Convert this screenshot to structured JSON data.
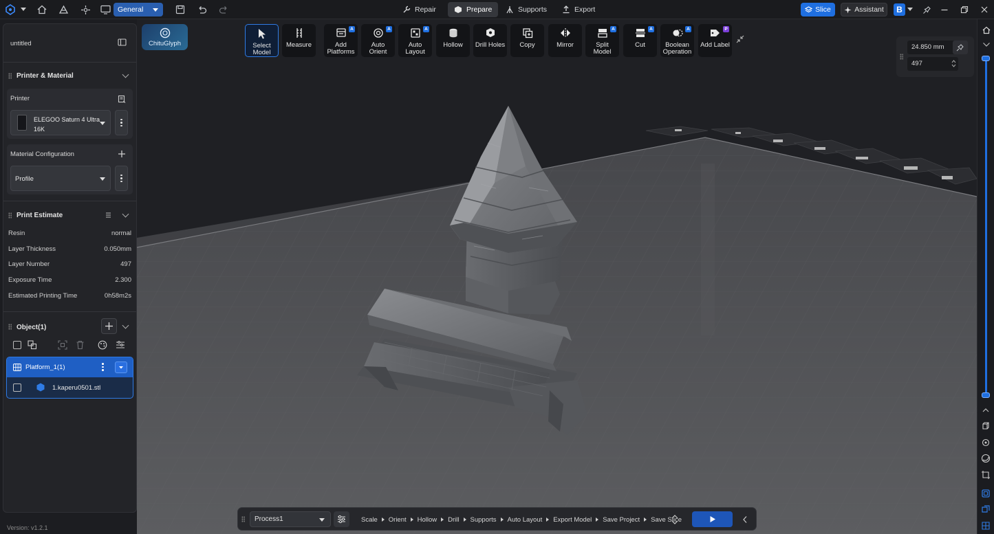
{
  "topbar": {
    "workspace": "General",
    "tabs": [
      {
        "label": "Repair",
        "icon": "wrench-icon"
      },
      {
        "label": "Prepare",
        "icon": "cube-icon"
      },
      {
        "label": "Supports",
        "icon": "support-icon"
      },
      {
        "label": "Export",
        "icon": "export-icon"
      }
    ],
    "active_tab": "Prepare",
    "slice_label": "Slice",
    "assistant_label": "Assistant",
    "profile_letter": "B",
    "accent_color": "#1f6fe0"
  },
  "tools": [
    {
      "label": [
        "Select",
        "Model"
      ],
      "icon": "cursor-icon"
    },
    {
      "label": [
        "Measure"
      ],
      "icon": "ruler-icon"
    },
    {
      "label": [
        "Add",
        "Platforms"
      ],
      "icon": "platforms-icon",
      "badge": "A"
    },
    {
      "label": [
        "Auto",
        "Orient"
      ],
      "icon": "orient-icon",
      "badge": "A"
    },
    {
      "label": [
        "Auto",
        "Layout"
      ],
      "icon": "layout-icon",
      "badge": "A"
    },
    {
      "label": [
        "Hollow"
      ],
      "icon": "hollow-icon"
    },
    {
      "label": [
        "Drill Holes"
      ],
      "icon": "drill-icon"
    },
    {
      "label": [
        "Copy"
      ],
      "icon": "copy-icon"
    },
    {
      "label": [
        "Mirror"
      ],
      "icon": "mirror-icon"
    },
    {
      "label": [
        "Split",
        "Model"
      ],
      "icon": "split-icon",
      "badge": "A"
    },
    {
      "label": [
        "Cut"
      ],
      "icon": "cut-icon",
      "badge": "A"
    },
    {
      "label": [
        "Boolean",
        "Operation"
      ],
      "icon": "boolean-icon",
      "badge": "A"
    },
    {
      "label": [
        "Add Label"
      ],
      "icon": "label-icon",
      "badge": "P"
    }
  ],
  "chitu": {
    "label": "ChituGlyph"
  },
  "project": {
    "title": "untitled"
  },
  "printer_material": {
    "header": "Printer & Material",
    "printer_label": "Printer",
    "printer_name": "ELEGOO Saturn 4 Ultra 16K",
    "material_label": "Material Configuration",
    "profile": "Profile"
  },
  "estimate": {
    "header": "Print Estimate",
    "rows": [
      {
        "label": "Resin",
        "value": "normal"
      },
      {
        "label": "Layer Thickness",
        "value": "0.050mm"
      },
      {
        "label": "Layer Number",
        "value": "497"
      },
      {
        "label": "Exposure Time",
        "value": "2.300"
      },
      {
        "label": "Estimated Printing Time",
        "value": "0h58m2s"
      }
    ]
  },
  "objects": {
    "header": "Object(1)",
    "platform": "Platform_1(1)",
    "file": "1.kaperu0501.stl"
  },
  "layer": {
    "height": "24.850 mm",
    "number": "497"
  },
  "bottombar": {
    "process": "Process1",
    "steps": [
      "Scale",
      "Orient",
      "Hollow",
      "Drill",
      "Supports",
      "Auto Layout",
      "Export Model",
      "Save Project",
      "Save Slice"
    ]
  },
  "version": "Version: v1.2.1"
}
